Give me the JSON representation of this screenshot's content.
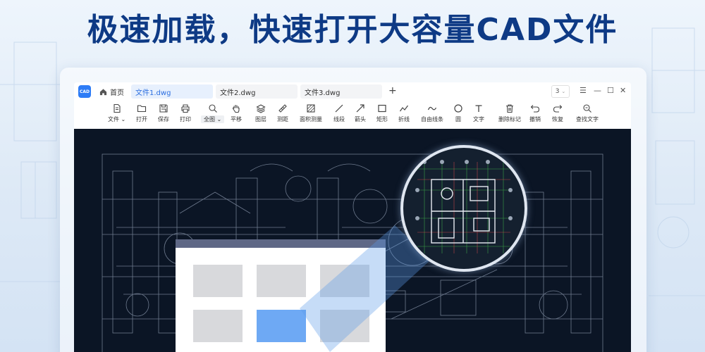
{
  "headline": "极速加载，快速打开大容量CAD文件",
  "app": {
    "logo_text": "CAD",
    "home_label": "首页",
    "tabs": [
      {
        "label": "文件1.dwg",
        "active": true
      },
      {
        "label": "文件2.dwg",
        "active": false
      },
      {
        "label": "文件3.dwg",
        "active": false
      }
    ],
    "add_tab": "+",
    "page_selector": "3",
    "window_controls": {
      "menu": "☰",
      "minimize": "—",
      "maximize": "☐",
      "close": "✕"
    }
  },
  "toolbar": [
    {
      "label": "文件 ⌄",
      "icon": "file-icon"
    },
    {
      "label": "打开",
      "icon": "folder-icon"
    },
    {
      "label": "保存",
      "icon": "save-icon"
    },
    {
      "label": "打印",
      "icon": "print-icon"
    },
    {
      "label": "全图 ⌄",
      "icon": "zoom-fit-icon"
    },
    {
      "label": "平移",
      "icon": "hand-icon"
    },
    {
      "label": "图层",
      "icon": "layers-icon"
    },
    {
      "label": "测距",
      "icon": "ruler-icon"
    },
    {
      "label": "面积测量",
      "icon": "area-icon"
    },
    {
      "label": "线段",
      "icon": "line-icon"
    },
    {
      "label": "箭头",
      "icon": "arrow-icon"
    },
    {
      "label": "矩形",
      "icon": "rectangle-icon"
    },
    {
      "label": "折线",
      "icon": "polyline-icon"
    },
    {
      "label": "自由线条",
      "icon": "freehand-icon"
    },
    {
      "label": "圆",
      "icon": "circle-icon"
    },
    {
      "label": "文字",
      "icon": "text-icon"
    },
    {
      "label": "删除标记",
      "icon": "trash-icon"
    },
    {
      "label": "撤销",
      "icon": "undo-icon"
    },
    {
      "label": "恢复",
      "icon": "redo-icon"
    },
    {
      "label": "查找文字",
      "icon": "find-text-icon"
    }
  ],
  "colors": {
    "accent": "#2d7cf6",
    "headline": "#0e3a85",
    "canvas": "#0b1525",
    "dialog_header": "#5f6886",
    "selected_thumb": "#6ea9f4"
  }
}
